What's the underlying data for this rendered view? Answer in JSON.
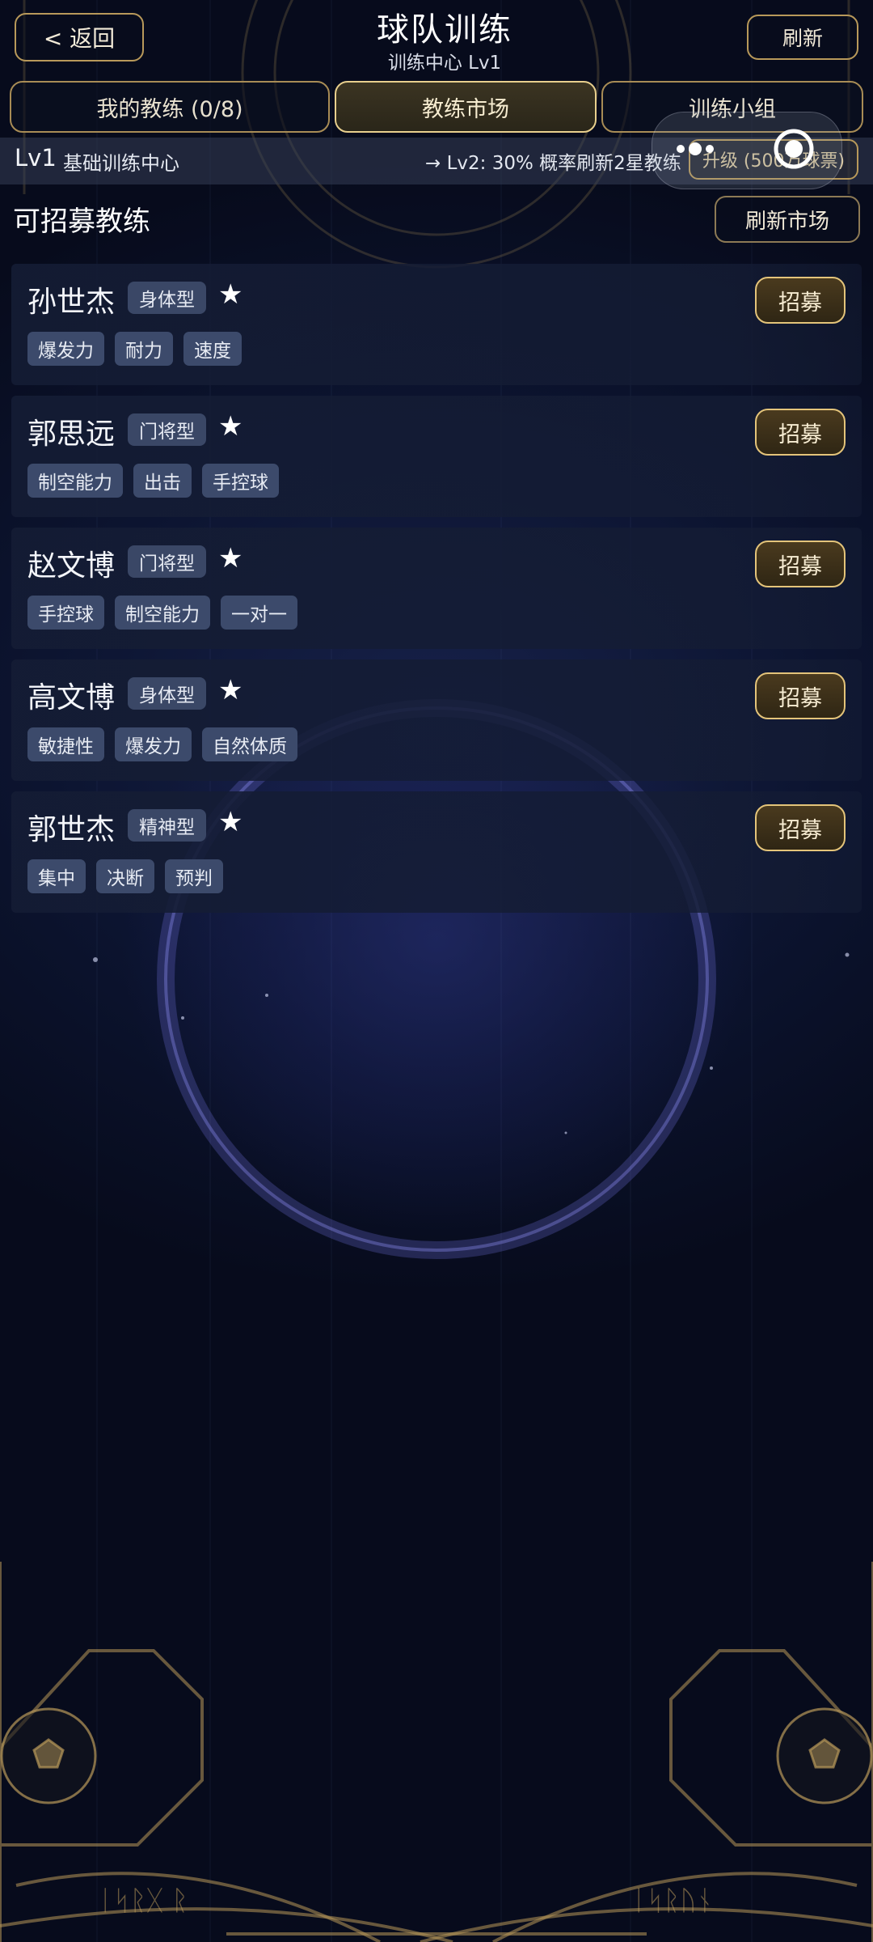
{
  "header": {
    "back_label": "< 返回",
    "title": "球队训练",
    "subtitle": "训练中心 Lv1",
    "refresh_label": "刷新"
  },
  "tabs": [
    {
      "label": "我的教练 (0/8)",
      "active": false
    },
    {
      "label": "教练市场",
      "active": true
    },
    {
      "label": "训练小组",
      "active": false
    }
  ],
  "level_bar": {
    "level": "Lv1",
    "center_name": "基础训练中心",
    "next_info": "→ Lv2: 30% 概率刷新2星教练",
    "upgrade_label": "升级 (500万球票)"
  },
  "section": {
    "title": "可招募教练",
    "refresh_market_label": "刷新市场"
  },
  "coaches": [
    {
      "name": "孙世杰",
      "type": "身体型",
      "star": "★",
      "tags": [
        "爆发力",
        "耐力",
        "速度"
      ],
      "action": "招募"
    },
    {
      "name": "郭思远",
      "type": "门将型",
      "star": "★",
      "tags": [
        "制空能力",
        "出击",
        "手控球"
      ],
      "action": "招募"
    },
    {
      "name": "赵文博",
      "type": "门将型",
      "star": "★",
      "tags": [
        "手控球",
        "制空能力",
        "一对一"
      ],
      "action": "招募"
    },
    {
      "name": "高文博",
      "type": "身体型",
      "star": "★",
      "tags": [
        "敏捷性",
        "爆发力",
        "自然体质"
      ],
      "action": "招募"
    },
    {
      "name": "郭世杰",
      "type": "精神型",
      "star": "★",
      "tags": [
        "集中",
        "决断",
        "预判"
      ],
      "action": "招募"
    }
  ],
  "icons": [
    "more-dots-icon",
    "record-circle-icon",
    "soccer-ball-icon"
  ],
  "colors": {
    "gold_border": "#b8995a",
    "gold_active": "#e8cf8d",
    "background": "#0c1430",
    "card_bg": "#141c34",
    "tag_bg": "#3c4a6b"
  }
}
